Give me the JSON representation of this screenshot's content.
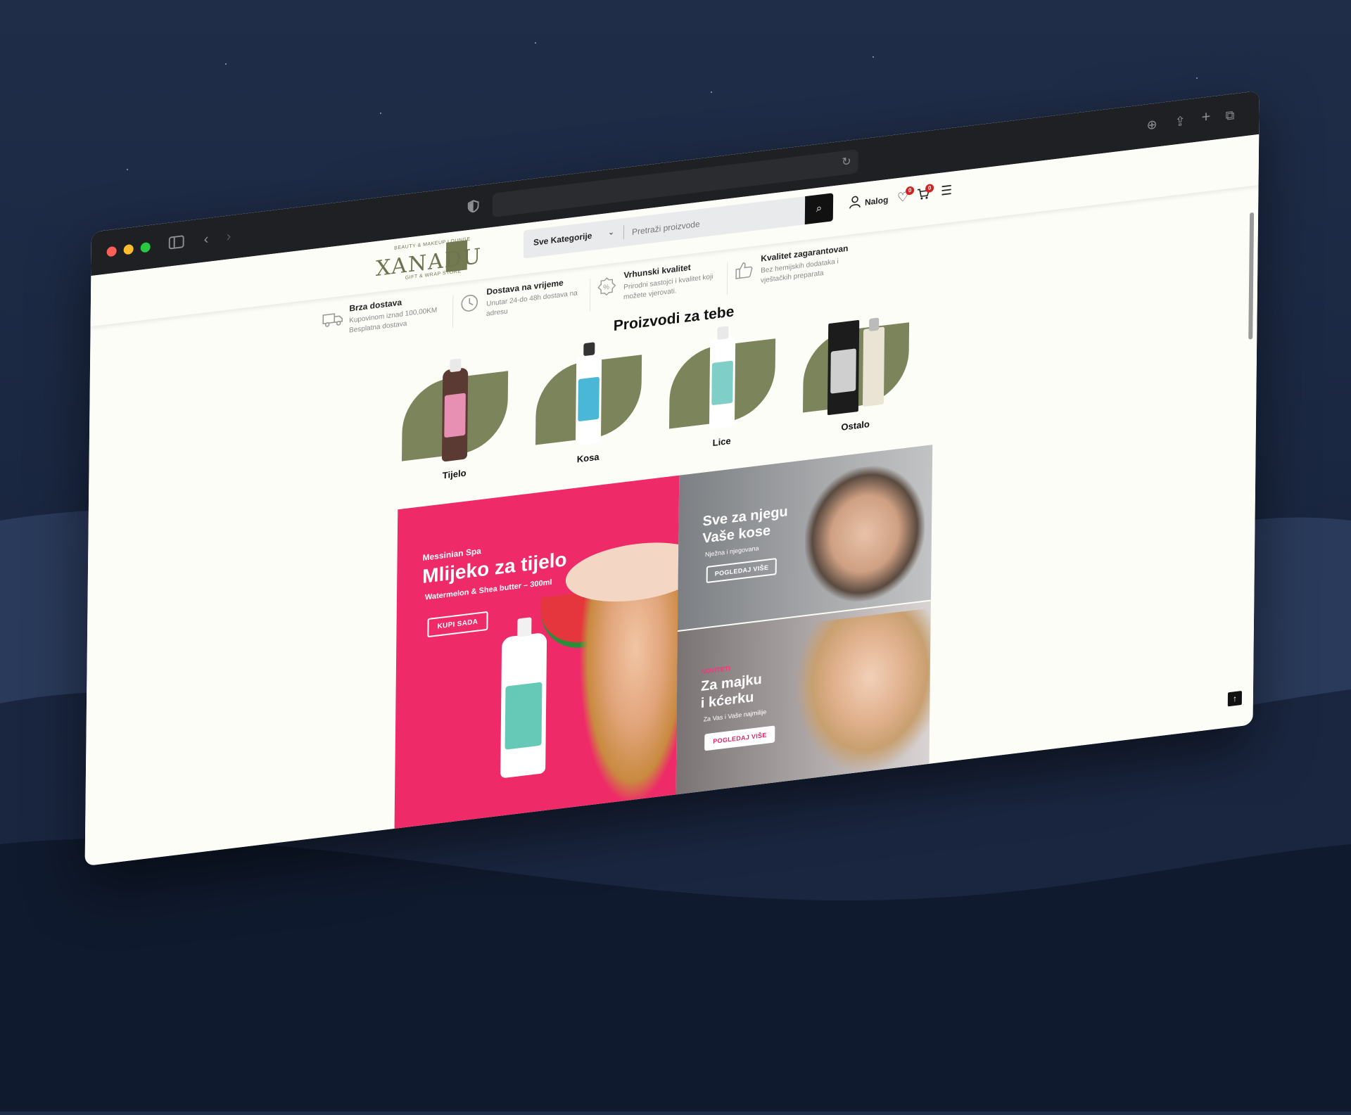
{
  "browser": {
    "url": "",
    "icons": [
      "sidebar-icon",
      "back-icon",
      "forward-icon",
      "shield-icon",
      "reload-icon",
      "download-icon",
      "share-icon",
      "new-tab-icon",
      "tabs-icon"
    ]
  },
  "header": {
    "logo": {
      "main": "XANADU",
      "top": "BEAUTY & MAKEUP LOUNGE",
      "bottom": "GIFT & WRAP STORE"
    },
    "category_select": "Sve Kategorije",
    "search_placeholder": "Pretraži proizvode",
    "account_label": "Nalog",
    "wishlist_count": "0",
    "cart_count": "0"
  },
  "features": [
    {
      "title": "Brza dostava",
      "desc": "Kupovinom iznad 100,00KM Besplatna dostava"
    },
    {
      "title": "Dostava na vrijeme",
      "desc": "Unutar 24-do 48h dostava na adresu"
    },
    {
      "title": "Vrhunski kvalitet",
      "desc": "Prirodni sastojci i kvalitet koji možete vjerovati."
    },
    {
      "title": "Kvalitet zagarantovan",
      "desc": "Bez hemijskih dodataka i vještačkih preparata"
    }
  ],
  "section_title": "Proizvodi za tebe",
  "categories": [
    {
      "name": "Tijelo",
      "bottle_color": "#5a3a33",
      "label_color": "#e88fb4"
    },
    {
      "name": "Kosa",
      "bottle_color": "#ffffff",
      "label_color": "#4ab7d6"
    },
    {
      "name": "Lice",
      "bottle_color": "#ffffff",
      "label_color": "#7fcfc8"
    },
    {
      "name": "Ostalo",
      "bottle_color": "#1c1c1c",
      "label_color": "#e9e4d4"
    }
  ],
  "hero": {
    "left": {
      "kicker": "Messinian Spa",
      "title": "Mlijeko za tijelo",
      "desc": "Watermelon & Shea butter – 300ml",
      "button": "KUPI SADA",
      "bg": "#ef2a68"
    },
    "right_top": {
      "title_line1": "Sve za njegu",
      "title_line2": "Vaše kose",
      "desc": "Nježna i njegovana",
      "button": "POGLEDAJ VIŠE"
    },
    "right_bottom": {
      "kicker": "NOVITETI",
      "title_line1": "Za majku",
      "title_line2": "i kćerku",
      "desc": "Za Vas i Vaše najmilije",
      "button": "POGLEDAJ VIŠE"
    }
  }
}
